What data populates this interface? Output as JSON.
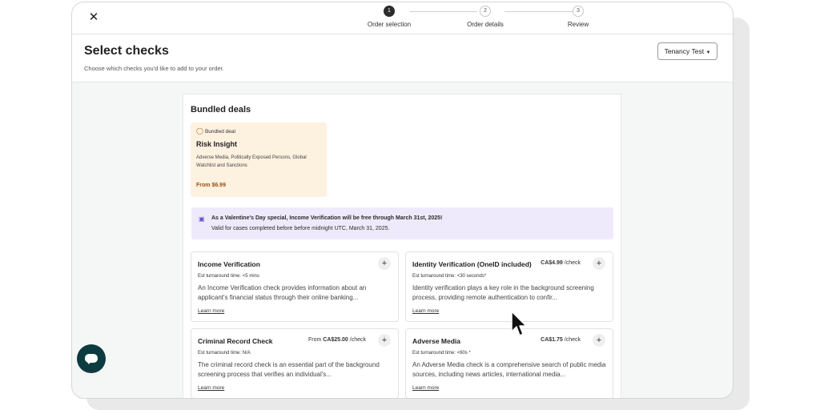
{
  "topbar": {
    "close_icon": "close-icon",
    "steps": [
      {
        "number": "1",
        "label": "Order selection",
        "state": "active"
      },
      {
        "number": "2",
        "label": "Order details",
        "state": "inactive"
      },
      {
        "number": "3",
        "label": "Review",
        "state": "inactive"
      }
    ]
  },
  "header": {
    "title": "Select checks",
    "subtitle": "Choose which checks you'd like to add to your order.",
    "tenancy_label": "Tenancy Test"
  },
  "bundled": {
    "section_title": "Bundled deals",
    "deal": {
      "tag": "Bundled deal",
      "name": "Risk Insight",
      "description": "Adverse Media, Politically Exposed Persons, Global Watchlist and Sanctions",
      "price": "From $6.99"
    }
  },
  "promo": {
    "line1": "As a Valentine's Day special, Income Verification will be free through March 31st, 2025!",
    "line2": "Valid for cases completed before before midnight UTC, March 31, 2025."
  },
  "checks": [
    {
      "title": "Income Verification",
      "price_prefix": "",
      "price": "",
      "price_unit": "",
      "turnaround": "Est turnaround time: <5 mins",
      "description": "An Income Verification check provides information about an applicant's financial status through their online banking...",
      "link": "Learn more"
    },
    {
      "title": "Identity Verification (OneID included)",
      "price_prefix": "",
      "price": "CA$4.99",
      "price_unit": "/check",
      "turnaround": "Est turnaround time: <30 seconds*",
      "description": "Identity verification plays a key role in the background screening process, providing remote authentication to confir...",
      "link": "Learn more"
    },
    {
      "title": "Criminal Record Check",
      "price_prefix": "From",
      "price": "CA$25.00",
      "price_unit": "/check",
      "turnaround": "Est turnaround time: N/A",
      "description": "The criminal record check is an essential part of the background screening process that verifies an individual's...",
      "link": "Learn more"
    },
    {
      "title": "Adverse Media",
      "price_prefix": "",
      "price": "CA$1.75",
      "price_unit": "/check",
      "turnaround": "Est turnaround time: <60s *",
      "description": "An Adverse Media check is a comprehensive search of public media sources, including news articles, international media...",
      "link": "Learn more"
    }
  ],
  "icons": {
    "close": "close-icon",
    "tag": "tag-icon",
    "gift": "gift-icon",
    "plus": "plus-icon",
    "chevron": "chevron-down-icon",
    "chat": "chat-icon",
    "cursor": "mouse-pointer-icon"
  },
  "colors": {
    "bundle_bg": "#fdf1e0",
    "bundle_price": "#9a4f12",
    "promo_bg": "#efeafb",
    "chat_button": "#0d3b3f"
  }
}
